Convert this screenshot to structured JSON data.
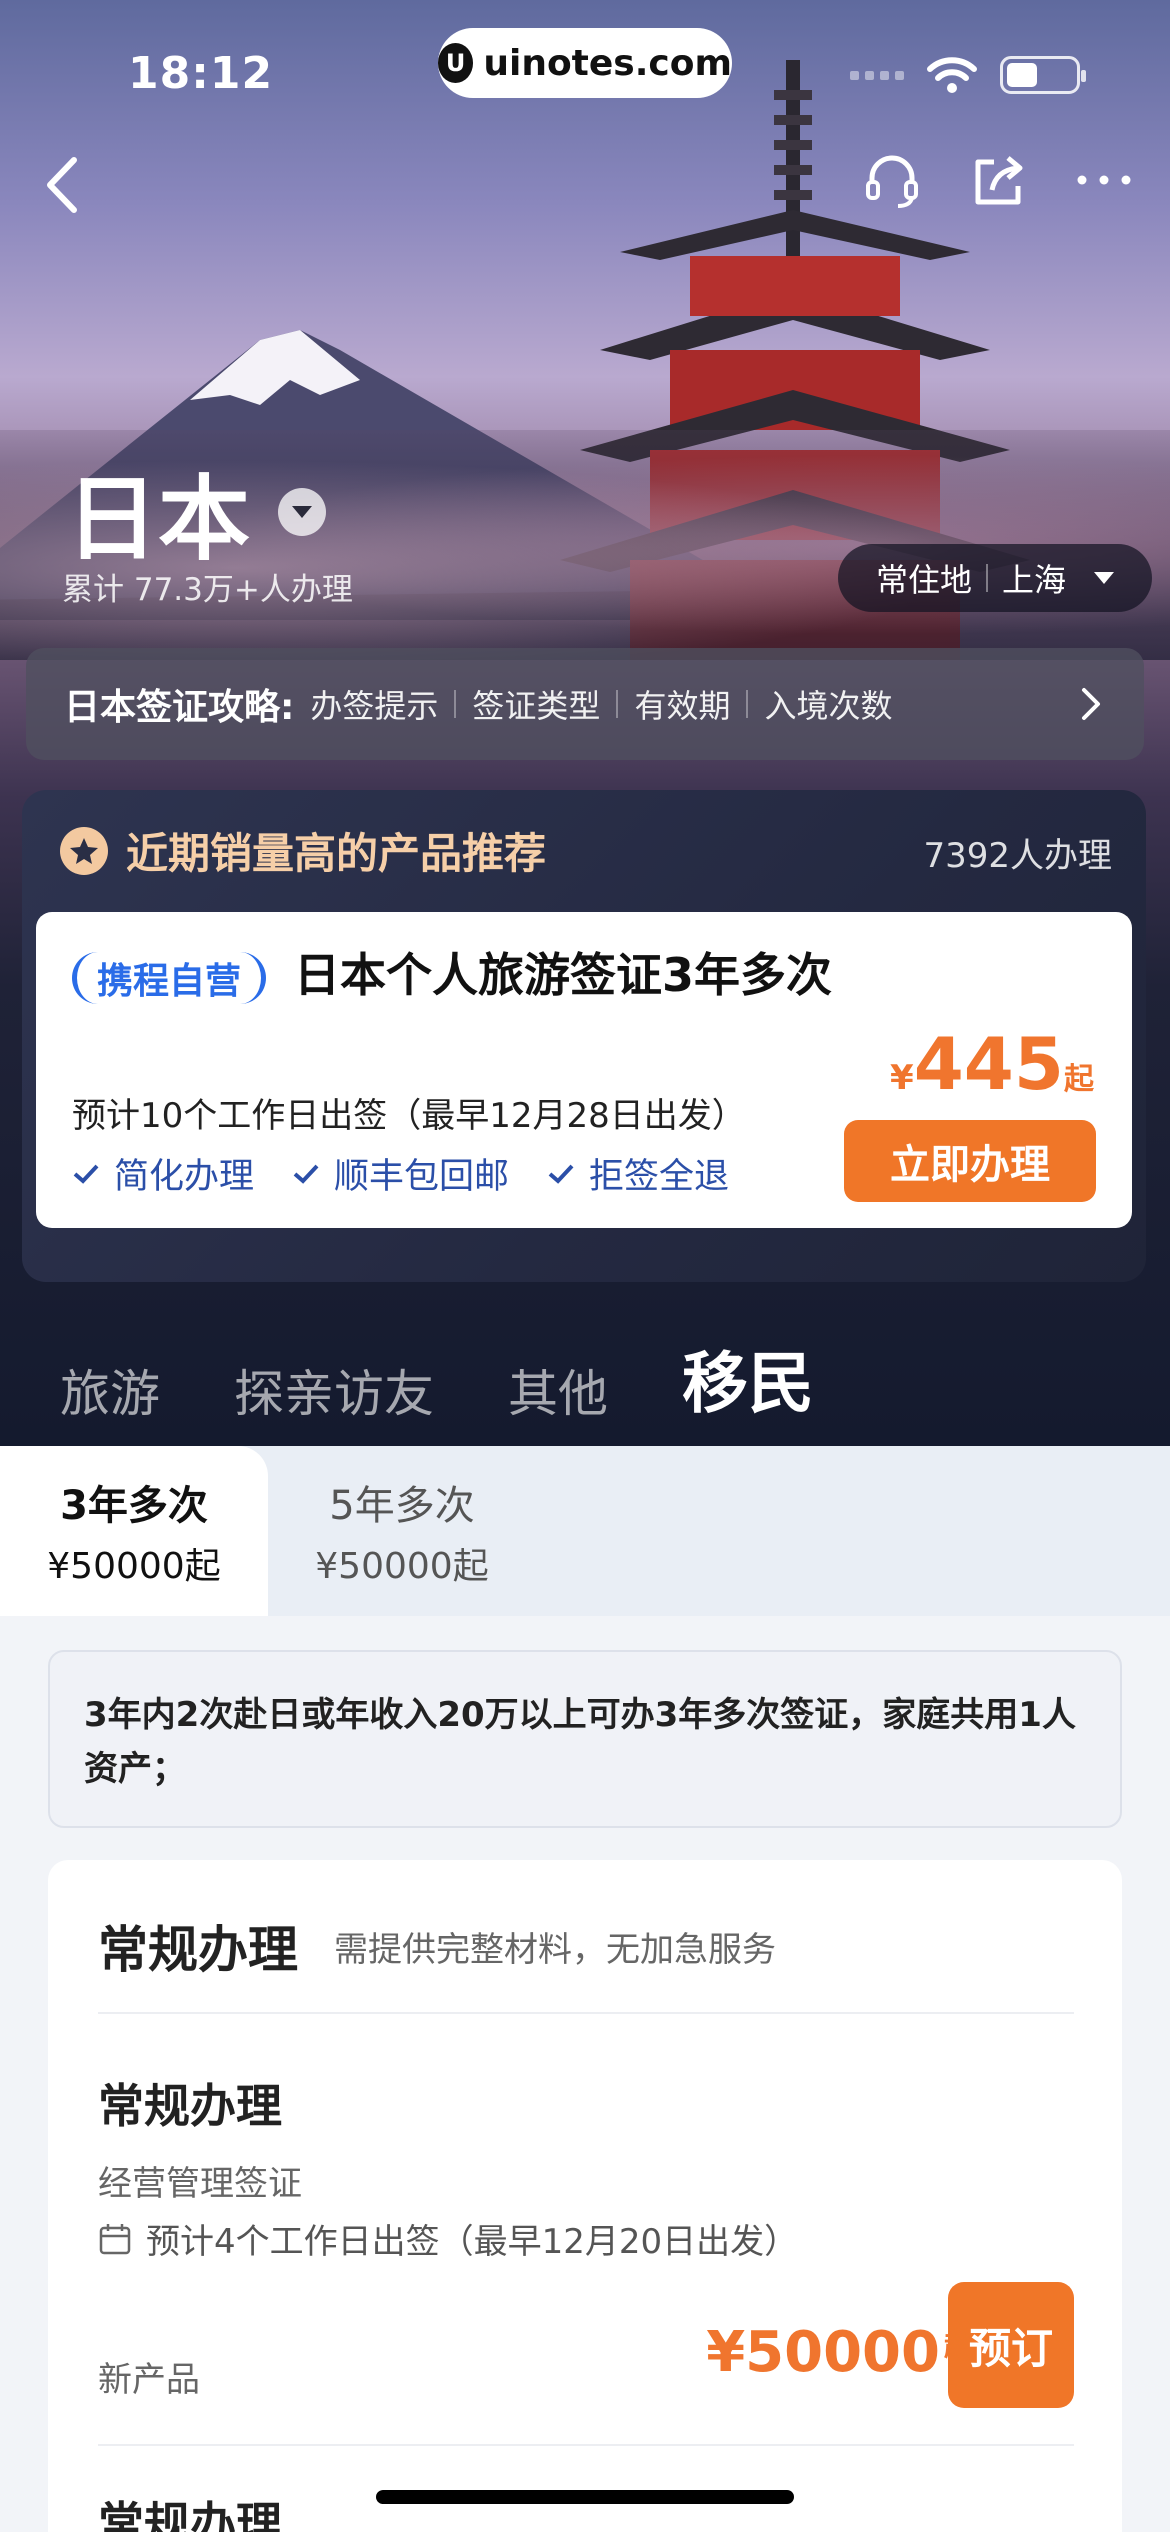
{
  "status_bar": {
    "time": "18:12",
    "watermark": "uinotes.com"
  },
  "header": {
    "country": "日本",
    "applied_count": "累计 77.3万+人办理",
    "residence_label": "常住地",
    "residence_city": "上海"
  },
  "guide": {
    "title": "日本签证攻略:",
    "items": [
      "办签提示",
      "签证类型",
      "有效期",
      "入境次数"
    ]
  },
  "recommend": {
    "title": "近期销量高的产品推荐",
    "count": "7392人办理",
    "badge": "携程自营",
    "product_title": "日本个人旅游签证3年多次",
    "desc": "预计10个工作日出签（最早12月28日出发）",
    "features": [
      "简化办理",
      "顺丰包回邮",
      "拒签全退"
    ],
    "price_currency": "¥",
    "price_value": "445",
    "price_suffix": "起",
    "button": "立即办理"
  },
  "category_tabs": [
    "旅游",
    "探亲访友",
    "其他",
    "移民"
  ],
  "active_category": 3,
  "sub_tabs": [
    {
      "label": "3年多次",
      "price": "¥50000起"
    },
    {
      "label": "5年多次",
      "price": "¥50000起"
    }
  ],
  "notice": "3年内2次赴日或年收入20万以上可办3年多次签证，家庭共用1人资产；",
  "service": {
    "title": "常规办理",
    "subtitle": "需提供完整材料，无加急服务",
    "item": {
      "title": "常规办理",
      "type": "经营管理签证",
      "date": "预计4个工作日出签（最早12月20日出发）",
      "tag": "新产品",
      "price": "¥50000",
      "price_suffix": "起",
      "button": "预订"
    },
    "next_item_title": "常规办理"
  },
  "colors": {
    "accent": "#f07628",
    "price": "#f0752e",
    "brand_blue": "#2a6ce8",
    "rec_title": "#f6cfa8"
  }
}
